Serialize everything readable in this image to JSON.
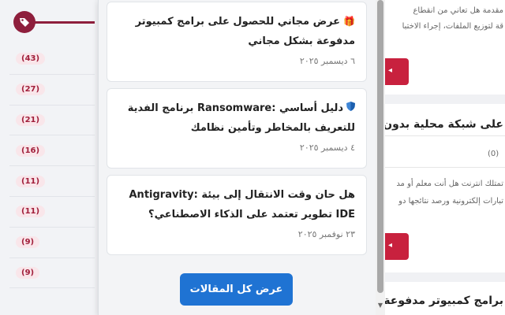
{
  "sidebar": {
    "counts": [
      "(43)",
      "(27)",
      "(21)",
      "(16)",
      "(11)",
      "(11)",
      "(9)",
      "(9)"
    ]
  },
  "background": {
    "line1": "مقدمة هل تعاني من انقطاع",
    "line2": "قة لتوزيع الملفات، إجراء الاختبا",
    "heading1": "على شبكة محلية بدون",
    "comments1": "(0)",
    "excerpt1a": "تمتلك انترنت هل أنت معلم أو مد",
    "excerpt1b": "تبارات إلكترونية ورصد نتائجها دو",
    "heading2": "برامج كمبيوتر مدفوعة"
  },
  "articles": [
    {
      "title": "عرض مجاني للحصول على برامج كمبيوتر مدفوعة بشكل مجاني",
      "icon": "gift-icon",
      "date": "٦ ديسمبر ٢٠٢٥"
    },
    {
      "title": "دليل أساسي :Ransomware برنامج الفدية للتعريف بالمخاطر وتأمين نظامك",
      "icon": "shield-icon",
      "date": "٤ ديسمبر ٢٠٢٥"
    },
    {
      "title": "هل حان وقت الانتقال إلى بيئة :Antigravity IDE تطوير تعتمد على الذكاء الاصطناعي؟",
      "icon": "",
      "date": "٢٣ نوفمبر ٢٠٢٥"
    }
  ],
  "view_all_label": "عرض كل المقالات",
  "colors": {
    "accent": "#1f73d3",
    "brand": "#8e1e3c",
    "badge": "#a11e3a"
  }
}
